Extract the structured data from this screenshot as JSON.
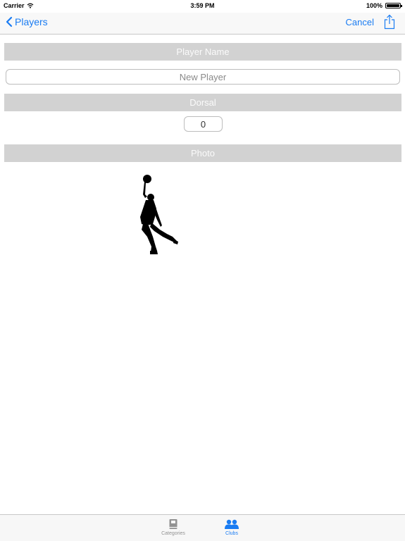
{
  "status_bar": {
    "carrier": "Carrier",
    "time": "3:59 PM",
    "battery": "100%",
    "battery_level": 1.0
  },
  "nav": {
    "back_label": "Players",
    "cancel_label": "Cancel",
    "share_icon": "share-icon"
  },
  "form": {
    "player_name_header": "Player Name",
    "player_name_placeholder": "New Player",
    "dorsal_header": "Dorsal",
    "dorsal_value": "0",
    "photo_header": "Photo",
    "photo_icon": "basketball-player-silhouette"
  },
  "tab_bar": {
    "items": [
      {
        "label": "Categories",
        "icon": "book-icon",
        "selected": false
      },
      {
        "label": "Clubs",
        "icon": "people-icon",
        "selected": true
      }
    ]
  },
  "colors": {
    "accent": "#1a7cf2",
    "section_header_bg": "#d2d2d2",
    "tab_inactive": "#929292"
  }
}
